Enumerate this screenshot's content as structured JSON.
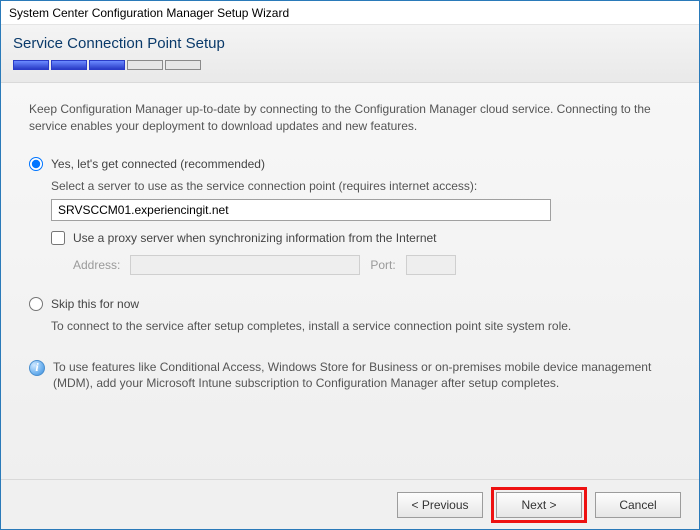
{
  "window": {
    "title": "System Center Configuration Manager Setup Wizard"
  },
  "header": {
    "title": "Service Connection Point Setup",
    "progress_total": 5,
    "progress_done": 3
  },
  "intro": "Keep Configuration Manager up-to-date by connecting to the Configuration Manager cloud service. Connecting to the service enables your deployment to download updates and new features.",
  "options": {
    "connected": {
      "label": "Yes, let's get connected (recommended)",
      "selected": true,
      "server_prompt": "Select a server to use as the service connection point (requires internet access):",
      "server_value": "SRVSCCM01.experiencingit.net",
      "proxy_checkbox_label": "Use a proxy server when synchronizing information from the Internet",
      "proxy_checked": false,
      "proxy_address_label": "Address:",
      "proxy_address_value": "",
      "proxy_port_label": "Port:",
      "proxy_port_value": ""
    },
    "skip": {
      "label": "Skip this for now",
      "selected": false,
      "description": "To connect to the service after setup completes, install a service connection point site system role."
    }
  },
  "info": {
    "text": "To use features like Conditional Access, Windows Store for Business or on-premises mobile device management (MDM), add your Microsoft Intune subscription to Configuration Manager after setup completes."
  },
  "buttons": {
    "previous": "< Previous",
    "next": "Next >",
    "cancel": "Cancel"
  }
}
